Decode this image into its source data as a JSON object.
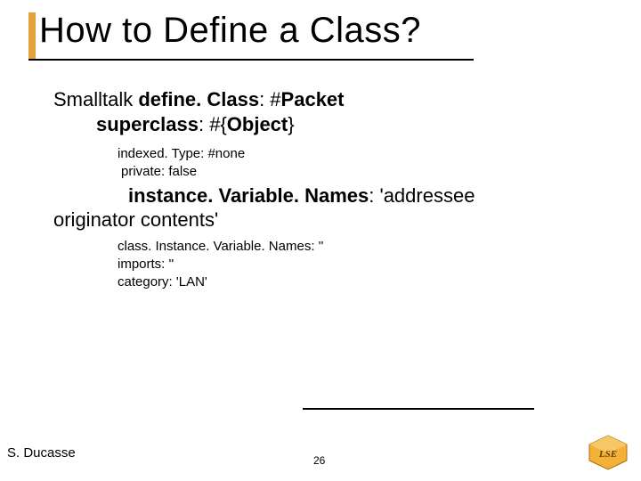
{
  "title": "How to Define a Class?",
  "code": {
    "l1a": "Smalltalk ",
    "l1b": "define. Class",
    "l1c": ": #",
    "l1d": "Packet",
    "l2a": "superclass",
    "l2b": ": #{",
    "l2c": "Object",
    "l2d": "}",
    "l3": "indexed. Type: #none",
    "l4": "private: false",
    "l5a": "instance. Variable. Names",
    "l5b": ": 'addressee",
    "l6": "originator contents'",
    "l7": "class. Instance. Variable. Names: ''",
    "l8": "imports: ''",
    "l9": "category: 'LAN'"
  },
  "footer": {
    "author": "S. Ducasse",
    "page": "26"
  }
}
